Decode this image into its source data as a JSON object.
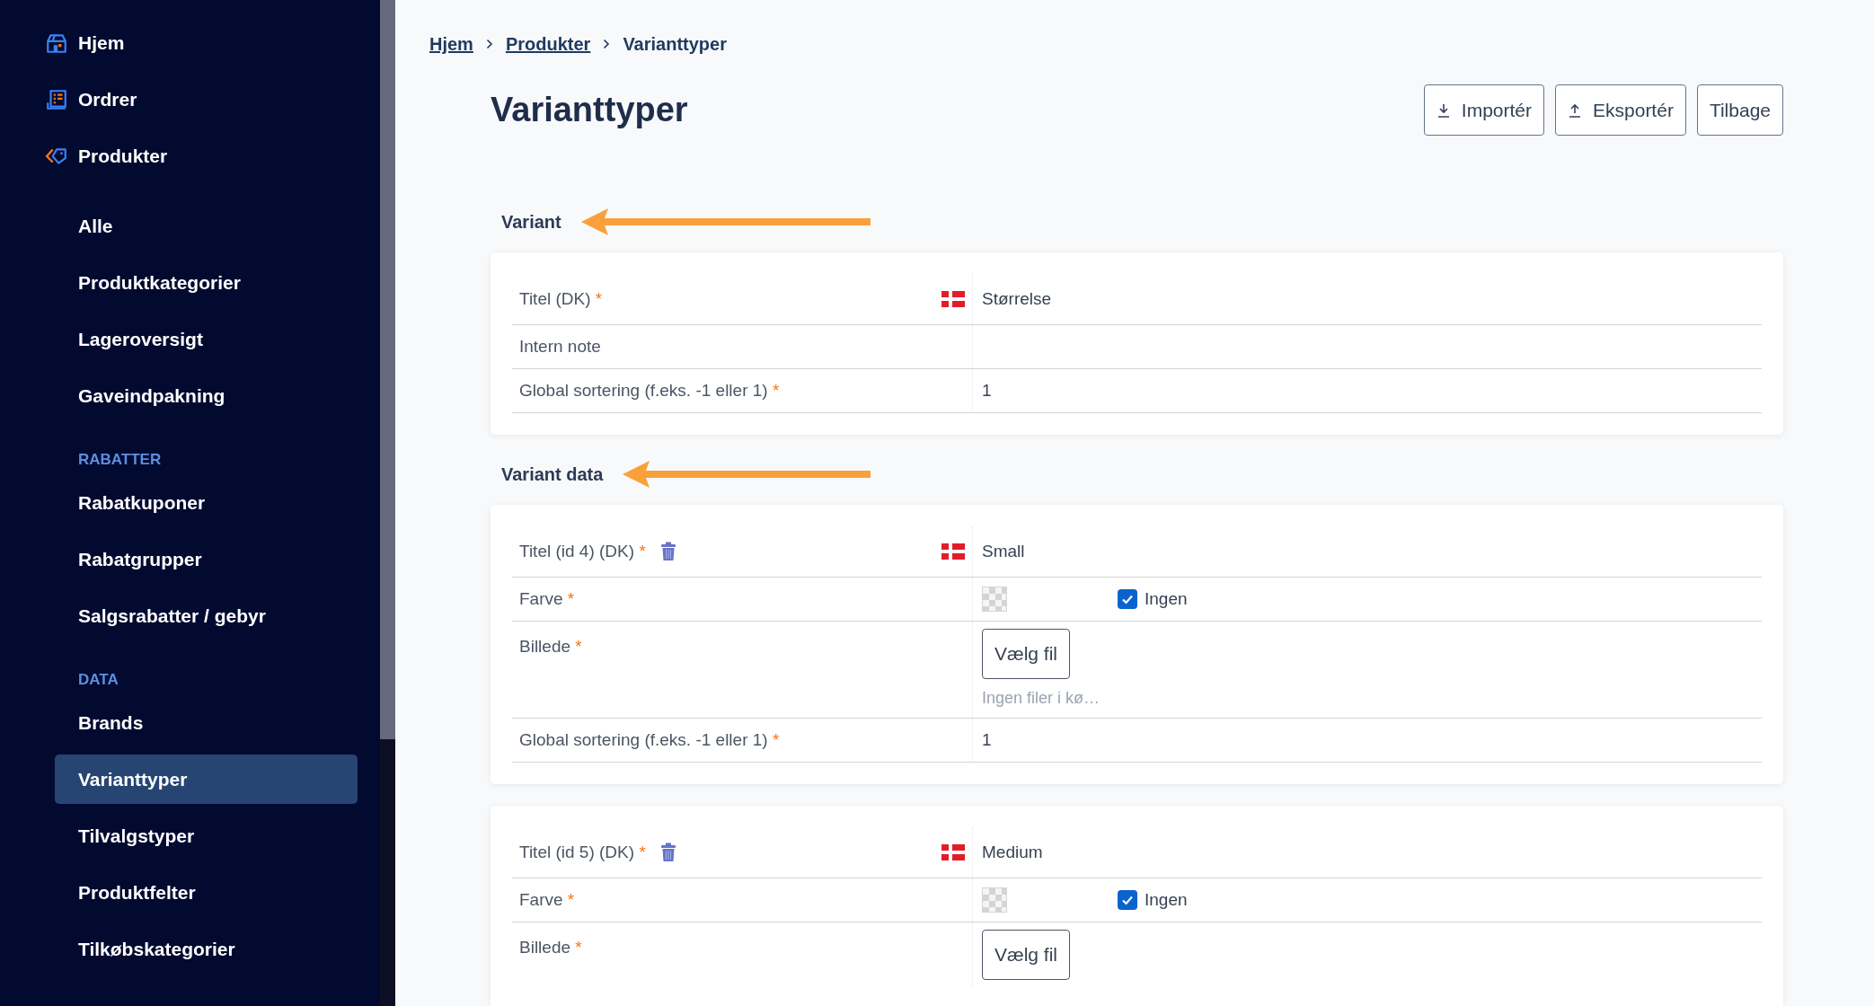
{
  "sidebar": {
    "items": [
      {
        "kind": "top",
        "label": "Hjem",
        "selected": false
      },
      {
        "kind": "top",
        "label": "Ordrer",
        "selected": false
      },
      {
        "kind": "top",
        "label": "Produkter",
        "selected": false
      },
      {
        "kind": "sub",
        "label": "Alle",
        "selected": false
      },
      {
        "kind": "sub",
        "label": "Produktkategorier",
        "selected": false
      },
      {
        "kind": "sub",
        "label": "Lageroversigt",
        "selected": false
      },
      {
        "kind": "sub",
        "label": "Gaveindpakning",
        "selected": false
      },
      {
        "kind": "heading",
        "label": "RABATTER"
      },
      {
        "kind": "sub",
        "label": "Rabatkuponer",
        "selected": false
      },
      {
        "kind": "sub",
        "label": "Rabatgrupper",
        "selected": false
      },
      {
        "kind": "sub",
        "label": "Salgsrabatter / gebyr",
        "selected": false
      },
      {
        "kind": "heading",
        "label": "DATA"
      },
      {
        "kind": "sub",
        "label": "Brands",
        "selected": false
      },
      {
        "kind": "sub",
        "label": "Varianttyper",
        "selected": true
      },
      {
        "kind": "sub",
        "label": "Tilvalgstyper",
        "selected": false
      },
      {
        "kind": "sub",
        "label": "Produktfelter",
        "selected": false
      },
      {
        "kind": "sub",
        "label": "Tilkøbskategorier",
        "selected": false
      }
    ]
  },
  "breadcrumb": [
    {
      "label": "Hjem",
      "link": true
    },
    {
      "label": "Produkter",
      "link": true
    },
    {
      "label": "Varianttyper",
      "link": false
    }
  ],
  "page_title": "Varianttyper",
  "actions": [
    {
      "kind": "import",
      "label": "Importér"
    },
    {
      "kind": "export",
      "label": "Eksportér"
    },
    {
      "kind": "plain",
      "label": "Tilbage"
    }
  ],
  "sections": [
    {
      "heading": "Variant",
      "cards": [
        {
          "rows": [
            {
              "kind": "text",
              "label": "Titel (DK)",
              "marker": "*",
              "flag": true,
              "deletable": false,
              "value": "Størrelse"
            },
            {
              "kind": "text",
              "label": "Intern note",
              "flag": false,
              "deletable": false
            },
            {
              "kind": "text",
              "label": "Global sortering (f.eks. -1 eller 1)",
              "marker": "*",
              "flag": false,
              "deletable": false,
              "value": "1"
            }
          ]
        }
      ]
    },
    {
      "heading": "Variant data",
      "cards": [
        {
          "rows": [
            {
              "kind": "text",
              "label": "Titel (id 4) (DK)",
              "marker": "*",
              "flag": true,
              "deletable": true,
              "value": "Small"
            },
            {
              "kind": "color",
              "label": "Farve",
              "marker": "*",
              "checked": true,
              "option": "Ingen"
            },
            {
              "kind": "file",
              "label": "Billede",
              "marker": "*",
              "button": "Vælg fil",
              "note": "Ingen filer i kø…"
            },
            {
              "kind": "text",
              "label": "Global sortering (f.eks. -1 eller 1)",
              "marker": "*",
              "flag": false,
              "deletable": false,
              "value": "1"
            }
          ]
        },
        {
          "rows": [
            {
              "kind": "text",
              "label": "Titel (id 5) (DK)",
              "marker": "*",
              "flag": true,
              "deletable": true,
              "value": "Medium"
            },
            {
              "kind": "color",
              "label": "Farve",
              "marker": "*",
              "checked": true,
              "option": "Ingen"
            },
            {
              "kind": "file",
              "label": "Billede",
              "marker": "*",
              "button": "Vælg fil"
            }
          ]
        }
      ]
    }
  ]
}
